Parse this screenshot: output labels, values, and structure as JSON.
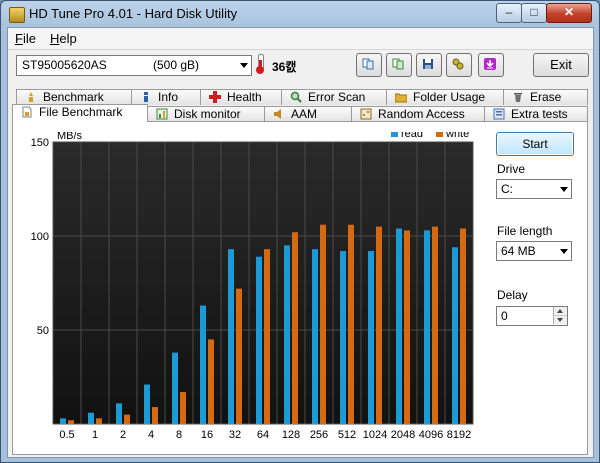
{
  "window": {
    "title": "HD Tune Pro 4.01 - Hard Disk Utility",
    "controls": {
      "minimize": "–",
      "maximize": "□",
      "close": "✕"
    }
  },
  "menu": [
    {
      "label": "File",
      "accel": "F",
      "rest": "ile"
    },
    {
      "label": "Help",
      "accel": "H",
      "rest": "elp"
    }
  ],
  "toolbar": {
    "drive_name": "ST95005620AS",
    "drive_size": "(500 gB)",
    "temperature": "36캜",
    "buttons": [
      {
        "name": "copy-info-icon",
        "color": "#3a6ea8"
      },
      {
        "name": "copy-screenshot-icon",
        "color": "#3a8a3a"
      },
      {
        "name": "save-icon",
        "color": "#2a4f8a"
      },
      {
        "name": "options-icon",
        "color": "#8a7a1a"
      },
      {
        "name": "download-icon",
        "color": "#b02ac8"
      }
    ],
    "exit_label": "Exit"
  },
  "tabs_row1": [
    {
      "label": "Benchmark",
      "icon": "benchmark-icon",
      "color": "#d8a020"
    },
    {
      "label": "Info",
      "icon": "info-icon",
      "color": "#2a5fb0"
    },
    {
      "label": "Health",
      "icon": "health-icon",
      "color": "#d21b1b"
    },
    {
      "label": "Error Scan",
      "icon": "error-scan-icon",
      "color": "#3a7a3a"
    },
    {
      "label": "Folder Usage",
      "icon": "folder-icon",
      "color": "#e0b030"
    },
    {
      "label": "Erase",
      "icon": "erase-icon",
      "color": "#505050"
    }
  ],
  "tabs_row2": [
    {
      "label": "File Benchmark",
      "icon": "file-benchmark-icon",
      "color": "#b0b0b0",
      "active": true
    },
    {
      "label": "Disk monitor",
      "icon": "disk-monitor-icon",
      "color": "#3a8a3a"
    },
    {
      "label": "AAM",
      "icon": "aam-icon",
      "color": "#c08a20"
    },
    {
      "label": "Random Access",
      "icon": "random-access-icon",
      "color": "#8a6a2a"
    },
    {
      "label": "Extra tests",
      "icon": "extra-tests-icon",
      "color": "#4a70b0"
    }
  ],
  "sidebar": {
    "start_label": "Start",
    "drive_label": "Drive",
    "drive_value": "C:",
    "file_length_label": "File length",
    "file_length_value": "64 MB",
    "delay_label": "Delay",
    "delay_value": "0"
  },
  "chart_data": {
    "type": "bar",
    "ylabel": "MB/s",
    "ylim": [
      0,
      150
    ],
    "yticks": [
      50,
      100,
      150
    ],
    "categories": [
      "0.5",
      "1",
      "2",
      "4",
      "8",
      "16",
      "32",
      "64",
      "128",
      "256",
      "512",
      "1024",
      "2048",
      "4096",
      "8192"
    ],
    "series": [
      {
        "name": "read",
        "color": "#1c9ad6",
        "values": [
          3,
          6,
          11,
          21,
          38,
          63,
          93,
          89,
          95,
          93,
          92,
          92,
          104,
          103,
          94
        ]
      },
      {
        "name": "write",
        "color": "#d46b12",
        "values": [
          2,
          3,
          5,
          9,
          17,
          45,
          72,
          93,
          102,
          106,
          106,
          105,
          103,
          105,
          104
        ]
      }
    ],
    "grid": true,
    "legend_position": "top-right",
    "background": "#1d1d1d"
  }
}
